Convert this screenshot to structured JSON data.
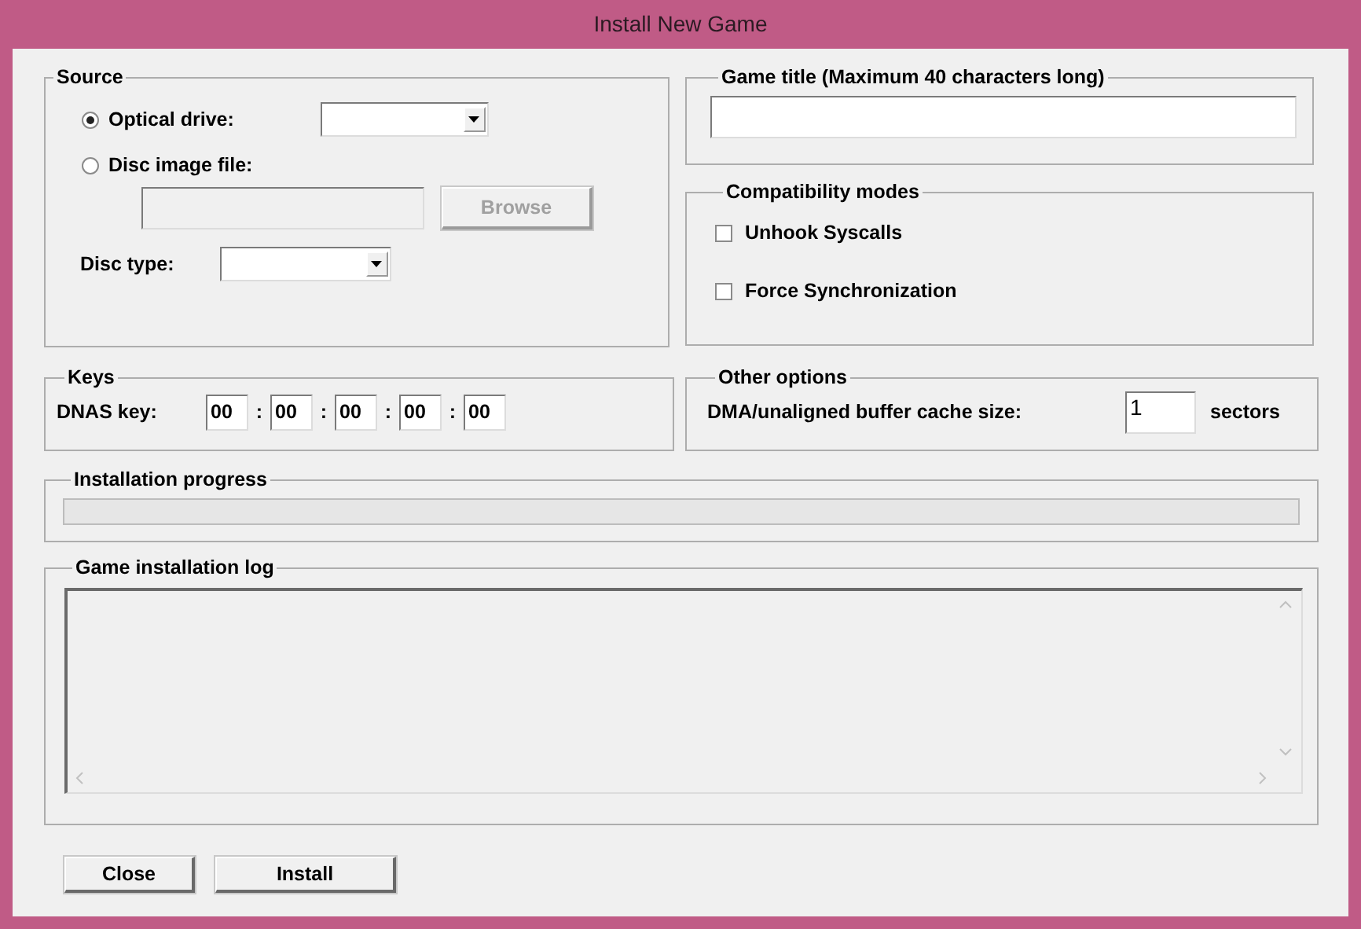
{
  "window": {
    "title": "Install New Game"
  },
  "source": {
    "label": "Source",
    "options": [
      {
        "label": "Optical drive:",
        "selected": true
      },
      {
        "label": "Disc image file:",
        "selected": false
      }
    ],
    "image_field": {
      "disabled": true
    },
    "browse_button": {
      "label": "Browse",
      "disabled": true
    },
    "disc_type_label": "Disc type:"
  },
  "game_title": {
    "label": "Game title (Maximum 40 characters long)"
  },
  "compatibility": {
    "label": "Compatibility modes",
    "options": [
      {
        "label": "Unhook Syscalls",
        "checked": false
      },
      {
        "label": "Force Synchronization",
        "checked": false
      }
    ]
  },
  "keys": {
    "label": "Keys",
    "dnas_label": "DNAS key:",
    "fields": [
      "00",
      "00",
      "00",
      "00",
      "00"
    ],
    "separators": [
      ":",
      ":",
      ":",
      ":"
    ]
  },
  "other": {
    "label": "Other options",
    "cache_label": "DMA/unaligned buffer cache size:",
    "cache_value": "1",
    "unit": "sectors"
  },
  "progress": {
    "label": "Installation progress",
    "level": 0
  },
  "log": {
    "label": "Game installation log"
  },
  "buttons": [
    {
      "label": "Close"
    },
    {
      "label": "Install"
    }
  ]
}
